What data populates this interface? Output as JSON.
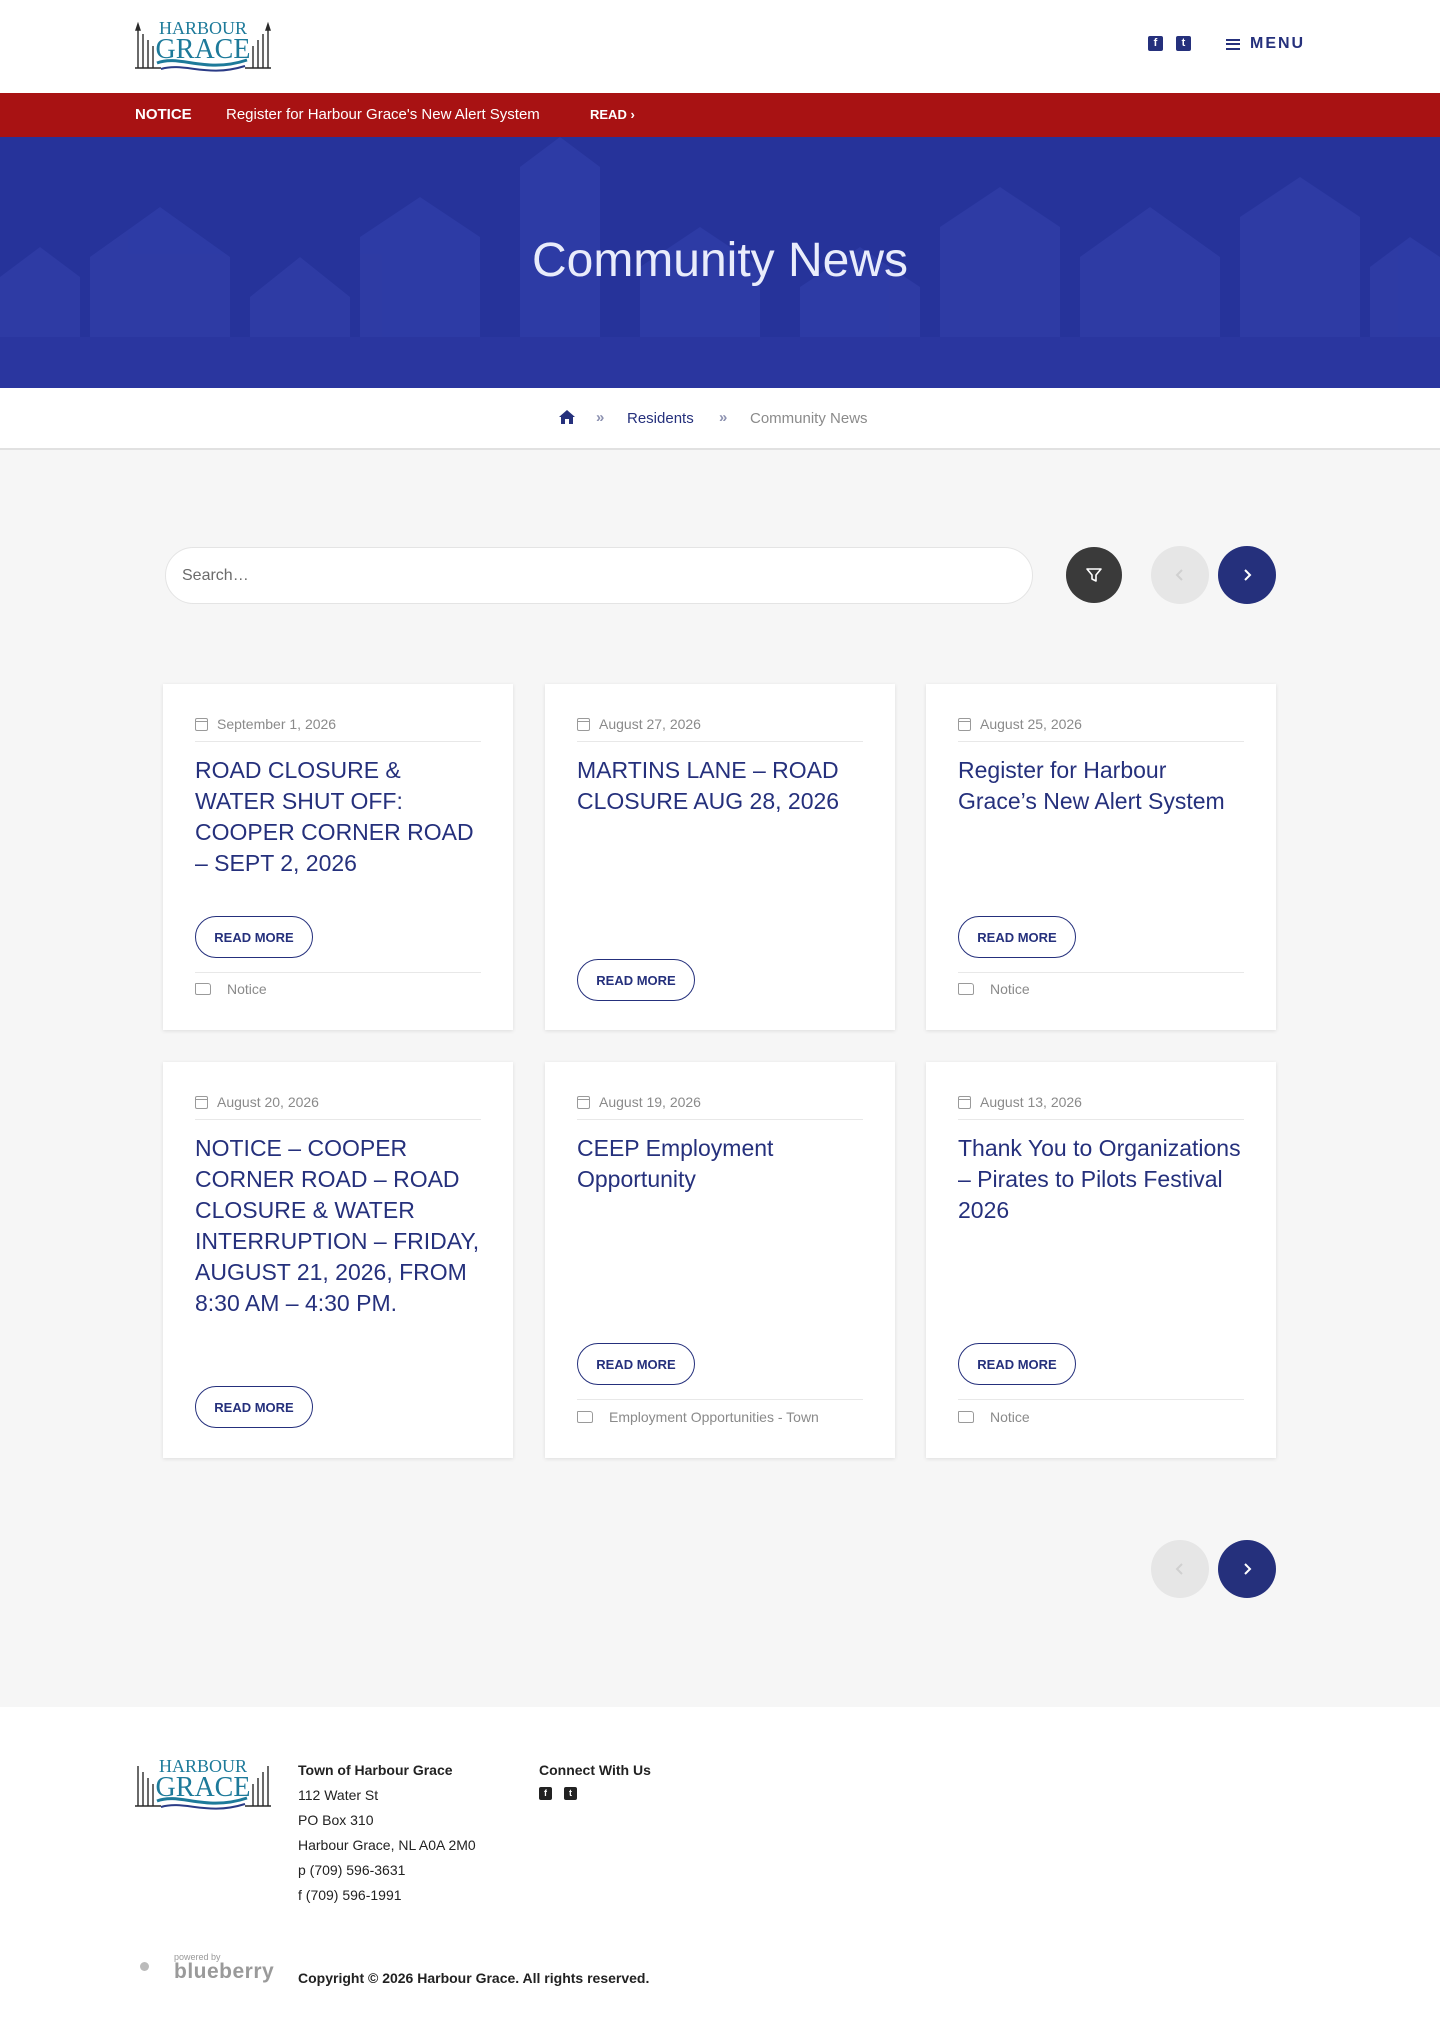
{
  "header": {
    "logo_text_top": "HARBOUR",
    "logo_text_bottom": "GRACE",
    "social": [
      {
        "icon": "facebook-icon",
        "glyph": "f"
      },
      {
        "icon": "twitter-icon",
        "glyph": "t"
      }
    ],
    "menu_label": "MENU"
  },
  "notice": {
    "tag": "NOTICE",
    "text": "Register for Harbour Grace's New Alert System",
    "read_label": "READ ›"
  },
  "hero": {
    "title": "Community News"
  },
  "breadcrumb": {
    "separator": "»",
    "items": [
      "Residents",
      "Community News"
    ]
  },
  "search": {
    "placeholder": "Search…"
  },
  "pagination": {
    "prev_glyph": "‹",
    "next_glyph": "›"
  },
  "read_more_label": "READ MORE",
  "cards": [
    {
      "date": "September 1, 2026",
      "title": "ROAD CLOSURE & WATER SHUT OFF: COOPER CORNER ROAD – SEPT 2, 2026",
      "category": "Notice"
    },
    {
      "date": "August 27, 2026",
      "title": "MARTINS LANE – ROAD CLOSURE AUG 28, 2026",
      "category": ""
    },
    {
      "date": "August 25, 2026",
      "title": "Register for Harbour Grace’s New Alert System",
      "category": "Notice"
    },
    {
      "date": "August 20, 2026",
      "title": "NOTICE – COOPER CORNER ROAD – ROAD CLOSURE & WATER INTERRUPTION – FRIDAY, AUGUST 21, 2026, FROM 8:30 AM – 4:30 PM.",
      "category": ""
    },
    {
      "date": "August 19, 2026",
      "title": "CEEP Employment Opportunity",
      "category": "Employment Opportunities - Town"
    },
    {
      "date": "August 13, 2026",
      "title": "Thank You to Organizations – Pirates to Pilots Festival 2026",
      "category": "Notice"
    }
  ],
  "footer": {
    "org": "Town of Harbour Grace",
    "address_lines": [
      "112 Water St",
      "PO Box 310",
      "Harbour Grace, NL A0A 2M0",
      "p (709) 596-3631",
      "f (709) 596-1991"
    ],
    "connect_label": "Connect With Us",
    "powered_small": "powered by",
    "powered_brand": "blueberry",
    "copyright": "Copyright © 2026 Harbour Grace. All rights reserved."
  },
  "colors": {
    "primary": "#25307c",
    "notice_bar": "#a81213",
    "hero_bg": "#26339a"
  }
}
